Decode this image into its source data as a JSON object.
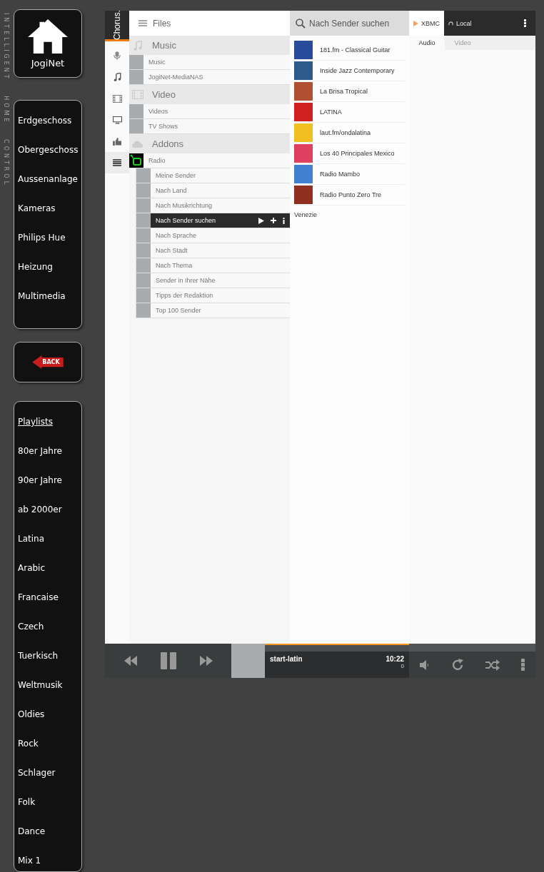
{
  "side_label": "INTELLIGENT HOME CONTROL",
  "home": {
    "label": "JogiNet"
  },
  "rooms": [
    {
      "label": "Erdgeschoss"
    },
    {
      "label": "Obergeschoss"
    },
    {
      "label": "Aussenanlage"
    },
    {
      "label": "Kameras"
    },
    {
      "label": "Philips Hue"
    },
    {
      "label": "Heizung"
    },
    {
      "label": "Multimedia"
    }
  ],
  "back": {
    "label": "BACK"
  },
  "playlists": {
    "title": "Playlists",
    "items": [
      {
        "label": "80er Jahre"
      },
      {
        "label": "90er Jahre"
      },
      {
        "label": "ab 2000er"
      },
      {
        "label": "Latina"
      },
      {
        "label": "Arabic"
      },
      {
        "label": "Francaise"
      },
      {
        "label": "Czech"
      },
      {
        "label": "Tuerkisch"
      },
      {
        "label": "Weltmusik"
      },
      {
        "label": "Oldies"
      },
      {
        "label": "Rock"
      },
      {
        "label": "Schlager"
      },
      {
        "label": "Folk"
      },
      {
        "label": "Dance"
      },
      {
        "label": "Mix 1"
      }
    ]
  },
  "chorus": {
    "brand": "Chorus.",
    "nav": [
      {
        "kind": "mic",
        "selected": false
      },
      {
        "kind": "music",
        "selected": false
      },
      {
        "kind": "film",
        "selected": false
      },
      {
        "kind": "monitor",
        "selected": false
      },
      {
        "kind": "thumb",
        "selected": false
      },
      {
        "kind": "list",
        "selected": true
      }
    ]
  },
  "files": {
    "title": "Files",
    "sections": [
      {
        "kind": "music",
        "title": "Music",
        "items": [
          {
            "label": "Music"
          },
          {
            "label": "JogiNet-MediaNAS"
          }
        ]
      },
      {
        "kind": "video",
        "title": "Video",
        "items": [
          {
            "label": "Videos"
          },
          {
            "label": "TV Shows"
          }
        ]
      },
      {
        "kind": "addons",
        "title": "Addons",
        "items": [
          {
            "label": "Radio",
            "kind": "addon",
            "children": [
              {
                "label": "Meine Sender",
                "selected": false
              },
              {
                "label": "Nach Land",
                "selected": false
              },
              {
                "label": "Nach Musikrichtung",
                "selected": false
              },
              {
                "label": "Nach Sender suchen",
                "selected": true
              },
              {
                "label": "Nach Sprache",
                "selected": false
              },
              {
                "label": "Nach Stadt",
                "selected": false
              },
              {
                "label": "Nach Thema",
                "selected": false
              },
              {
                "label": "Sender in Ihrer Nähe",
                "selected": false
              },
              {
                "label": "Tipps der Redaktion",
                "selected": false
              },
              {
                "label": "Top 100 Sender",
                "selected": false
              }
            ]
          }
        ]
      }
    ]
  },
  "search": {
    "placeholder": "Nach Sender suchen"
  },
  "stations": [
    {
      "name": "181.fm - Classical Guitar",
      "color": "#2a4a9a"
    },
    {
      "name": "Inside Jazz Contemporary",
      "color": "#2d5a8a"
    },
    {
      "name": "La Brisa Tropical",
      "color": "#b05030"
    },
    {
      "name": "LATINA",
      "color": "#d02020"
    },
    {
      "name": "laut.fm/ondalatina",
      "color": "#f0c020"
    },
    {
      "name": "Los 40 Principales Mexico",
      "color": "#e04060"
    },
    {
      "name": "Radio Mambo",
      "color": "#4080d0"
    },
    {
      "name": "Radio Punto Zero Tre",
      "color": "#903020"
    }
  ],
  "stations_footer": "Venezie",
  "player_tabs": [
    {
      "label": "XBMC",
      "kind": "xbmc",
      "selected": true
    },
    {
      "label": "Local",
      "kind": "local",
      "selected": false
    }
  ],
  "media_tabs": [
    {
      "label": "Audio",
      "selected": true
    },
    {
      "label": "Video",
      "selected": false
    }
  ],
  "player": {
    "title": "start-latin",
    "time": "10:22",
    "count": "0",
    "playing": true,
    "progress": {
      "level": 1
    }
  }
}
